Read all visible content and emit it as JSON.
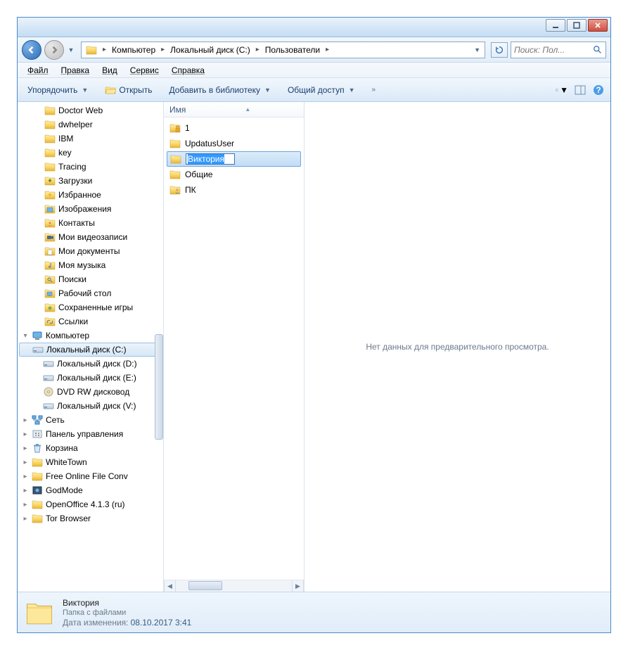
{
  "titlebar": {
    "min": "—",
    "max": "▢",
    "close": "✕"
  },
  "nav": {
    "breadcrumbs": [
      "Компьютер",
      "Локальный диск (C:)",
      "Пользователи"
    ],
    "dropdown_arrow": "▾",
    "refresh": "↻"
  },
  "search": {
    "placeholder": "Поиск: Пол..."
  },
  "menubar": [
    "Файл",
    "Правка",
    "Вид",
    "Сервис",
    "Справка"
  ],
  "toolbar": {
    "organize": "Упорядочить",
    "open": "Открыть",
    "add_library": "Добавить в библиотеку",
    "share": "Общий доступ",
    "more": "»"
  },
  "tree": [
    {
      "label": "Doctor Web",
      "indent": 2,
      "icon": "folder"
    },
    {
      "label": "dwhelper",
      "indent": 2,
      "icon": "folder"
    },
    {
      "label": "IBM",
      "indent": 2,
      "icon": "folder"
    },
    {
      "label": "key",
      "indent": 2,
      "icon": "folder"
    },
    {
      "label": "Tracing",
      "indent": 2,
      "icon": "folder"
    },
    {
      "label": "Загрузки",
      "indent": 2,
      "icon": "downloads"
    },
    {
      "label": "Избранное",
      "indent": 2,
      "icon": "favorites"
    },
    {
      "label": "Изображения",
      "indent": 2,
      "icon": "pictures"
    },
    {
      "label": "Контакты",
      "indent": 2,
      "icon": "contacts"
    },
    {
      "label": "Мои видеозаписи",
      "indent": 2,
      "icon": "videos"
    },
    {
      "label": "Мои документы",
      "indent": 2,
      "icon": "documents"
    },
    {
      "label": "Моя музыка",
      "indent": 2,
      "icon": "music"
    },
    {
      "label": "Поиски",
      "indent": 2,
      "icon": "searches"
    },
    {
      "label": "Рабочий стол",
      "indent": 2,
      "icon": "desktop"
    },
    {
      "label": "Сохраненные игры",
      "indent": 2,
      "icon": "games"
    },
    {
      "label": "Ссылки",
      "indent": 2,
      "icon": "links"
    },
    {
      "label": "Компьютер",
      "indent": 0,
      "icon": "computer",
      "expanded": true
    },
    {
      "label": "Локальный диск (C:)",
      "indent": 1,
      "icon": "disk",
      "selected": true
    },
    {
      "label": "Локальный диск (D:)",
      "indent": 1,
      "icon": "disk"
    },
    {
      "label": "Локальный диск (E:)",
      "indent": 1,
      "icon": "disk"
    },
    {
      "label": "DVD RW дисковод",
      "indent": 1,
      "icon": "dvd"
    },
    {
      "label": "Локальный диск (V:)",
      "indent": 1,
      "icon": "disk"
    },
    {
      "label": "Сеть",
      "indent": 0,
      "icon": "network"
    },
    {
      "label": "Панель управления",
      "indent": 0,
      "icon": "control"
    },
    {
      "label": "Корзина",
      "indent": 0,
      "icon": "recycle"
    },
    {
      "label": "WhiteTown",
      "indent": 0,
      "icon": "folder"
    },
    {
      "label": "Free Online File Conv",
      "indent": 0,
      "icon": "folder"
    },
    {
      "label": "GodMode",
      "indent": 0,
      "icon": "godmode"
    },
    {
      "label": "OpenOffice 4.1.3 (ru)",
      "indent": 0,
      "icon": "folder"
    },
    {
      "label": "Tor Browser",
      "indent": 0,
      "icon": "folder"
    }
  ],
  "list": {
    "header": "Имя",
    "items": [
      {
        "name": "1",
        "icon": "locked-folder"
      },
      {
        "name": "UpdatusUser",
        "icon": "folder"
      },
      {
        "name": "Виктория",
        "icon": "folder",
        "editing": true
      },
      {
        "name": "Общие",
        "icon": "folder"
      },
      {
        "name": "ПК",
        "icon": "user-folder"
      }
    ]
  },
  "preview": {
    "empty": "Нет данных для предварительного просмотра."
  },
  "details": {
    "name": "Виктория",
    "type": "Папка с файлами",
    "modified_label": "Дата изменения:",
    "modified_value": "08.10.2017 3:41"
  }
}
